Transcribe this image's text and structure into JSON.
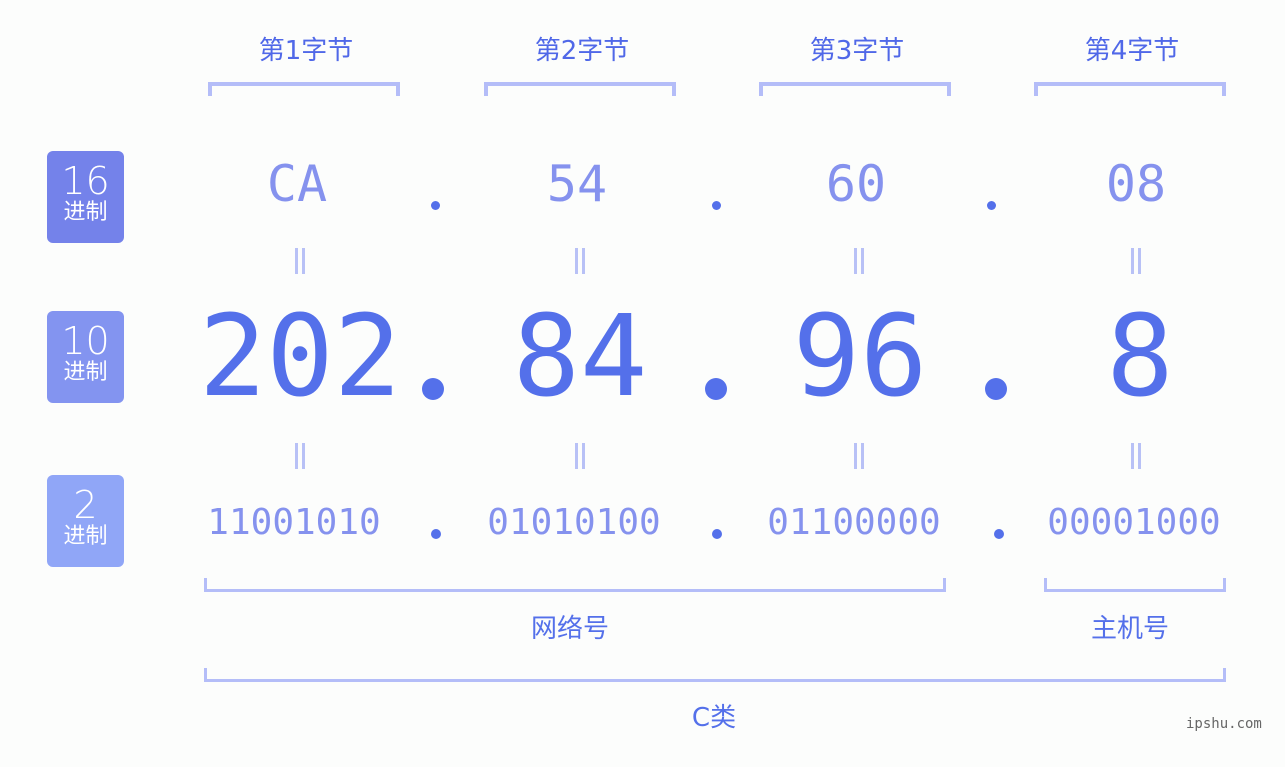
{
  "bytes": [
    {
      "label": "第1字节",
      "hex": "CA",
      "dec": "202",
      "bin": "11001010"
    },
    {
      "label": "第2字节",
      "hex": "54",
      "dec": "84",
      "bin": "01010100"
    },
    {
      "label": "第3字节",
      "hex": "60",
      "dec": "96",
      "bin": "01100000"
    },
    {
      "label": "第4字节",
      "hex": "08",
      "dec": "8",
      "bin": "00001000"
    }
  ],
  "badges": [
    {
      "num": "16",
      "unit": "进制",
      "color": "#7482ea"
    },
    {
      "num": "10",
      "unit": "进制",
      "color": "#8394f0"
    },
    {
      "num": "2",
      "unit": "进制",
      "color": "#90a6f7"
    }
  ],
  "separator": ".",
  "network_label": "网络号",
  "host_label": "主机号",
  "class_label": "C类",
  "watermark": "ipshu.com",
  "colors": {
    "primary": "#5470ea",
    "light": "#8592ee",
    "bracket": "#b4bdf8"
  }
}
